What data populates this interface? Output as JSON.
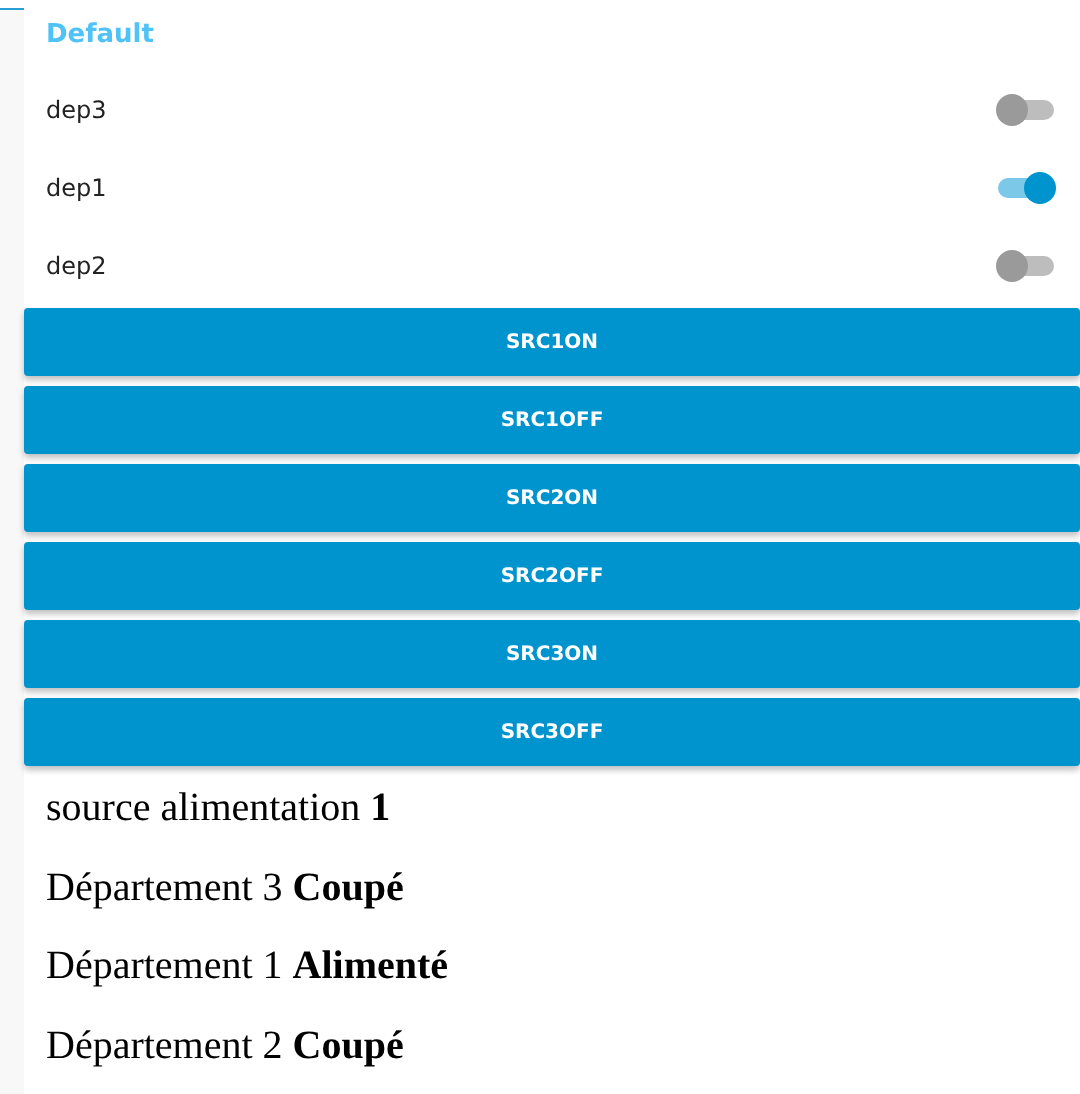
{
  "group": {
    "title": "Default"
  },
  "switches": [
    {
      "label": "dep3",
      "on": false
    },
    {
      "label": "dep1",
      "on": true
    },
    {
      "label": "dep2",
      "on": false
    }
  ],
  "buttons": [
    "SRC1ON",
    "SRC1OFF",
    "SRC2ON",
    "SRC2OFF",
    "SRC3ON",
    "SRC3OFF"
  ],
  "status_lines": [
    "source alimentation **1**",
    "Département 3 **Coupé**",
    "Département 1 **Alimenté**",
    "Département 2 **Coupé**"
  ]
}
